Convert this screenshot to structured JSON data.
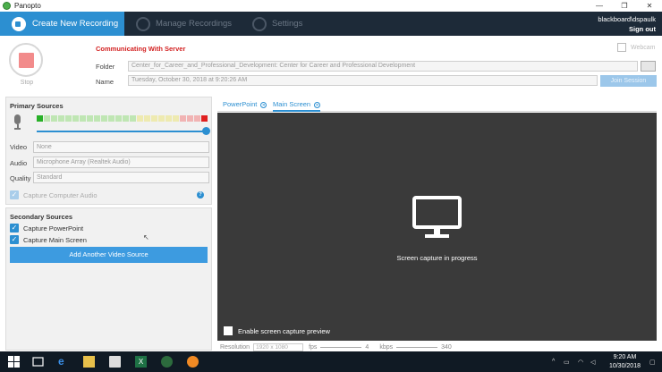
{
  "window": {
    "title": "Panopto",
    "controls": [
      "—",
      "❐",
      "✕"
    ]
  },
  "nav": {
    "create": "Create New Recording",
    "manage": "Manage Recordings",
    "settings": "Settings",
    "user": "blackboard\\dspaulk",
    "signout": "Sign out"
  },
  "recording": {
    "stop_label": "Stop",
    "status": "Communicating With Server",
    "folder_label": "Folder",
    "folder_value": "Center_for_Career_and_Professional_Development: Center for Career and Professional Development",
    "name_label": "Name",
    "name_value": "Tuesday, October 30, 2018 at 9:20:26 AM",
    "join_button": "Join Session",
    "webcam_label": "Webcam"
  },
  "primary": {
    "title": "Primary Sources",
    "audio_level_fraction": 0.02,
    "gain_fraction": 1.0,
    "video_label": "Video",
    "video_value": "None",
    "audio_label": "Audio",
    "audio_value": "Microphone Array (Realtek Audio)",
    "quality_label": "Quality",
    "quality_value": "Standard",
    "capture_audio": "Capture Computer Audio"
  },
  "secondary": {
    "title": "Secondary Sources",
    "capture_pp": "Capture PowerPoint",
    "capture_ms": "Capture Main Screen",
    "add_button": "Add Another Video Source"
  },
  "preview": {
    "tab1": "PowerPoint",
    "tab2": "Main Screen",
    "status": "Screen capture in progress",
    "enable_preview": "Enable screen capture preview",
    "resolution_label": "Resolution",
    "resolution_value": "1920 x 1080",
    "fps_label": "fps",
    "fps_value": "4",
    "kbps_label": "kbps",
    "kbps_value": "340"
  },
  "taskbar": {
    "time": "9:20 AM",
    "date": "10/30/2018"
  },
  "colors": {
    "accent": "#2c8fd1",
    "nav_bg": "#1d2a38",
    "status_red": "#d32222"
  }
}
